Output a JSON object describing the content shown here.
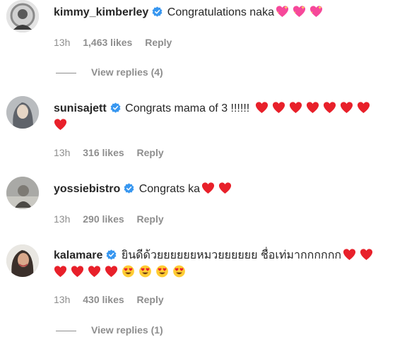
{
  "comments": [
    {
      "username": "kimmy_kimberley",
      "text": "Congratulations naka",
      "emoji": [
        "sparkling-heart",
        "sparkling-heart",
        "sparkling-heart"
      ],
      "time": "13h",
      "likes": "1,463 likes",
      "reply": "Reply",
      "view_replies": "View replies (4)"
    },
    {
      "username": "sunisajett",
      "text": "Congrats mama of 3 !!!!!!",
      "emoji": [
        "red-heart",
        "red-heart",
        "red-heart",
        "red-heart",
        "red-heart",
        "red-heart",
        "red-heart",
        "red-heart"
      ],
      "time": "13h",
      "likes": "316 likes",
      "reply": "Reply"
    },
    {
      "username": "yossiebistro",
      "text": "Congrats ka",
      "emoji": [
        "red-heart",
        "red-heart"
      ],
      "time": "13h",
      "likes": "290 likes",
      "reply": "Reply"
    },
    {
      "username": "kalamare",
      "text": "ยินดีด้วยยยยยยหมวยยยยยย ชื่อเท่มากกกกกก",
      "emoji": [
        "red-heart",
        "red-heart",
        "red-heart",
        "red-heart",
        "red-heart",
        "red-heart",
        "heart-eyes",
        "heart-eyes",
        "heart-eyes",
        "heart-eyes"
      ],
      "time": "13h",
      "likes": "430 likes",
      "reply": "Reply",
      "view_replies": "View replies (1)"
    }
  ],
  "colors": {
    "text": "#262626",
    "muted": "#8e8e8e",
    "verified": "#3897f0",
    "heart": "#e8202a",
    "sparkling_heart": "#f6489a",
    "emoji_face": "#ffcc33"
  }
}
